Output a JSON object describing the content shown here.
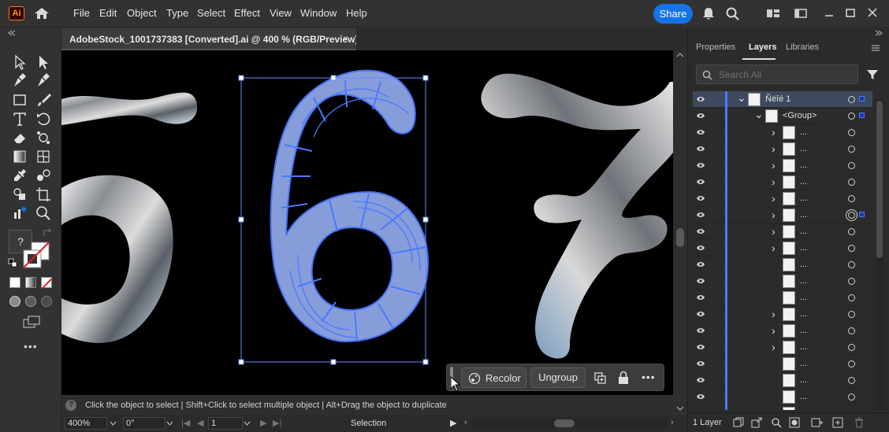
{
  "app": {
    "logo": "Ai"
  },
  "menu": [
    "File",
    "Edit",
    "Object",
    "Type",
    "Select",
    "Effect",
    "View",
    "Window",
    "Help"
  ],
  "share_label": "Share",
  "document": {
    "tab_title": "AdobeStock_1001737383 [Converted].ai @ 400 % (RGB/Preview)",
    "close": "×"
  },
  "context_bar": {
    "recolor": "Recolor",
    "ungroup": "Ungroup"
  },
  "hint": {
    "icon": "?",
    "text": "Click the object to select  |  Shift+Click to select multiple object  |  Alt+Drag the object to duplicate"
  },
  "status": {
    "zoom": "400%",
    "rotation": "0°",
    "artboard": "1",
    "tool": "Selection"
  },
  "panel": {
    "tabs": [
      "Properties",
      "Layers",
      "Libraries"
    ],
    "search_placeholder": "Search All",
    "layer_name": "Ñëîé 1",
    "group_name": "<Group>",
    "ellipsis": "...",
    "layers_count": "1 Layer"
  },
  "toolbar": {
    "unknown_tool": "?"
  },
  "colors": {
    "accent": "#1473e6",
    "selection": "#4a78ff",
    "logo_border": "#ff7c00"
  }
}
